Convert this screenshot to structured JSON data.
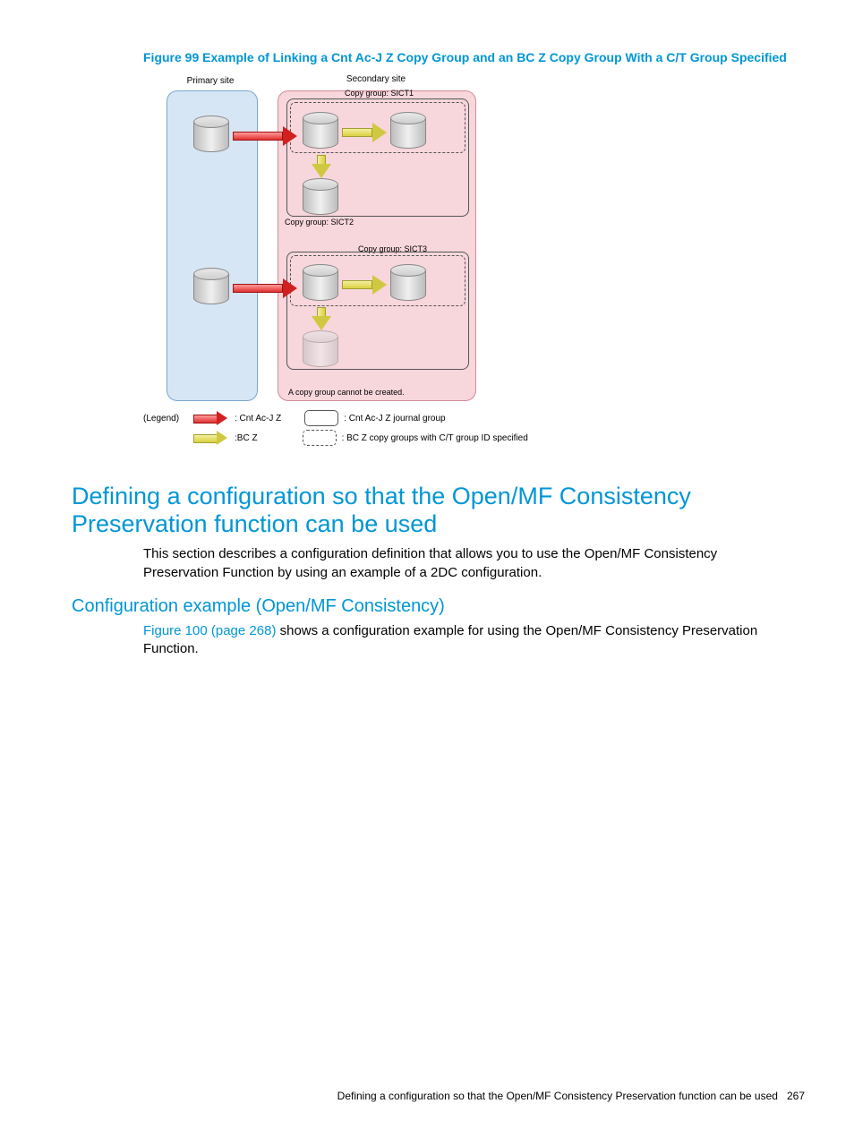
{
  "figure": {
    "caption": "Figure 99 Example of Linking a Cnt Ac-J Z Copy Group and an BC Z Copy Group With a C/T Group Specified",
    "primary_site_label": "Primary site",
    "secondary_site_label": "Secondary site",
    "cg_sict1": "Copy group: SICT1",
    "cg_sict2": "Copy group: SICT2",
    "cg_sict3": "Copy group: SICT3",
    "cannot_create": "A copy group cannot be created.",
    "legend_label": "(Legend)",
    "legend_cnt_acj": ": Cnt Ac-J Z",
    "legend_bcz": ":BC Z",
    "legend_journal": ": Cnt Ac-J Z journal group",
    "legend_bcz_ct": ": BC Z copy groups with C/T group ID specified"
  },
  "sections": {
    "h1": "Defining a configuration so that the Open/MF Consistency Preservation function can be used",
    "p1": "This section describes a configuration definition that allows you to use the Open/MF Consistency Preservation Function by using an example of a 2DC configuration.",
    "h2": "Configuration example (Open/MF Consistency)",
    "p2_link": "Figure 100 (page 268)",
    "p2_rest": " shows a configuration example for using the Open/MF Consistency Preservation Function."
  },
  "footer": {
    "text": "Defining a configuration so that the Open/MF Consistency Preservation function can be used",
    "page": "267"
  }
}
